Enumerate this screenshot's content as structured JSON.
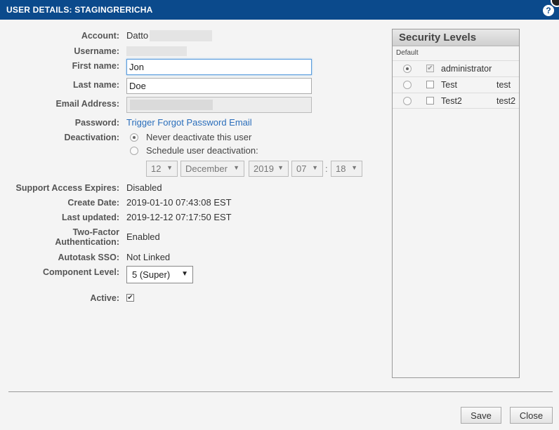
{
  "dialog": {
    "title": "USER DETAILS: STAGINGRERICHA",
    "help_glyph": "?"
  },
  "form": {
    "account_label": "Account:",
    "account_value": "Datto",
    "username_label": "Username:",
    "first_name_label": "First name:",
    "first_name_value": "Jon",
    "last_name_label": "Last name:",
    "last_name_value": "Doe",
    "email_label": "Email Address:",
    "password_label": "Password:",
    "password_link": "Trigger Forgot Password Email",
    "deactivation_label": "Deactivation:",
    "deactivation_options": [
      "Never deactivate this user",
      "Schedule user deactivation:"
    ],
    "deactivation_selected": "Never deactivate this user",
    "schedule": {
      "day": "12",
      "month": "December",
      "year": "2019",
      "hour": "07",
      "separator": ":",
      "minute": "18"
    },
    "support_access_label": "Support Access Expires:",
    "support_access_value": "Disabled",
    "create_date_label": "Create Date:",
    "create_date_value": "2019-01-10 07:43:08 EST",
    "last_updated_label": "Last updated:",
    "last_updated_value": "2019-12-12 07:17:50 EST",
    "two_factor_label_1": "Two-Factor",
    "two_factor_label_2": "Authentication:",
    "two_factor_value": "Enabled",
    "autotask_label": "Autotask SSO:",
    "autotask_value": "Not Linked",
    "component_label": "Component Level:",
    "component_value": "5 (Super)",
    "active_label": "Active:",
    "active_checked": true
  },
  "security_levels": {
    "title": "Security Levels",
    "default_header": "Default",
    "rows": [
      {
        "name": "administrator",
        "code": "",
        "default": true,
        "checked": true,
        "disabled": true
      },
      {
        "name": "Test",
        "code": "test",
        "default": false,
        "checked": false,
        "disabled": false
      },
      {
        "name": "Test2",
        "code": "test2",
        "default": false,
        "checked": false,
        "disabled": false
      }
    ]
  },
  "footer": {
    "save_label": "Save",
    "close_label": "Close"
  },
  "colors": {
    "titlebar": "#0b4a8c",
    "link": "#2a6ebb",
    "focus": "#5b9ddd"
  }
}
